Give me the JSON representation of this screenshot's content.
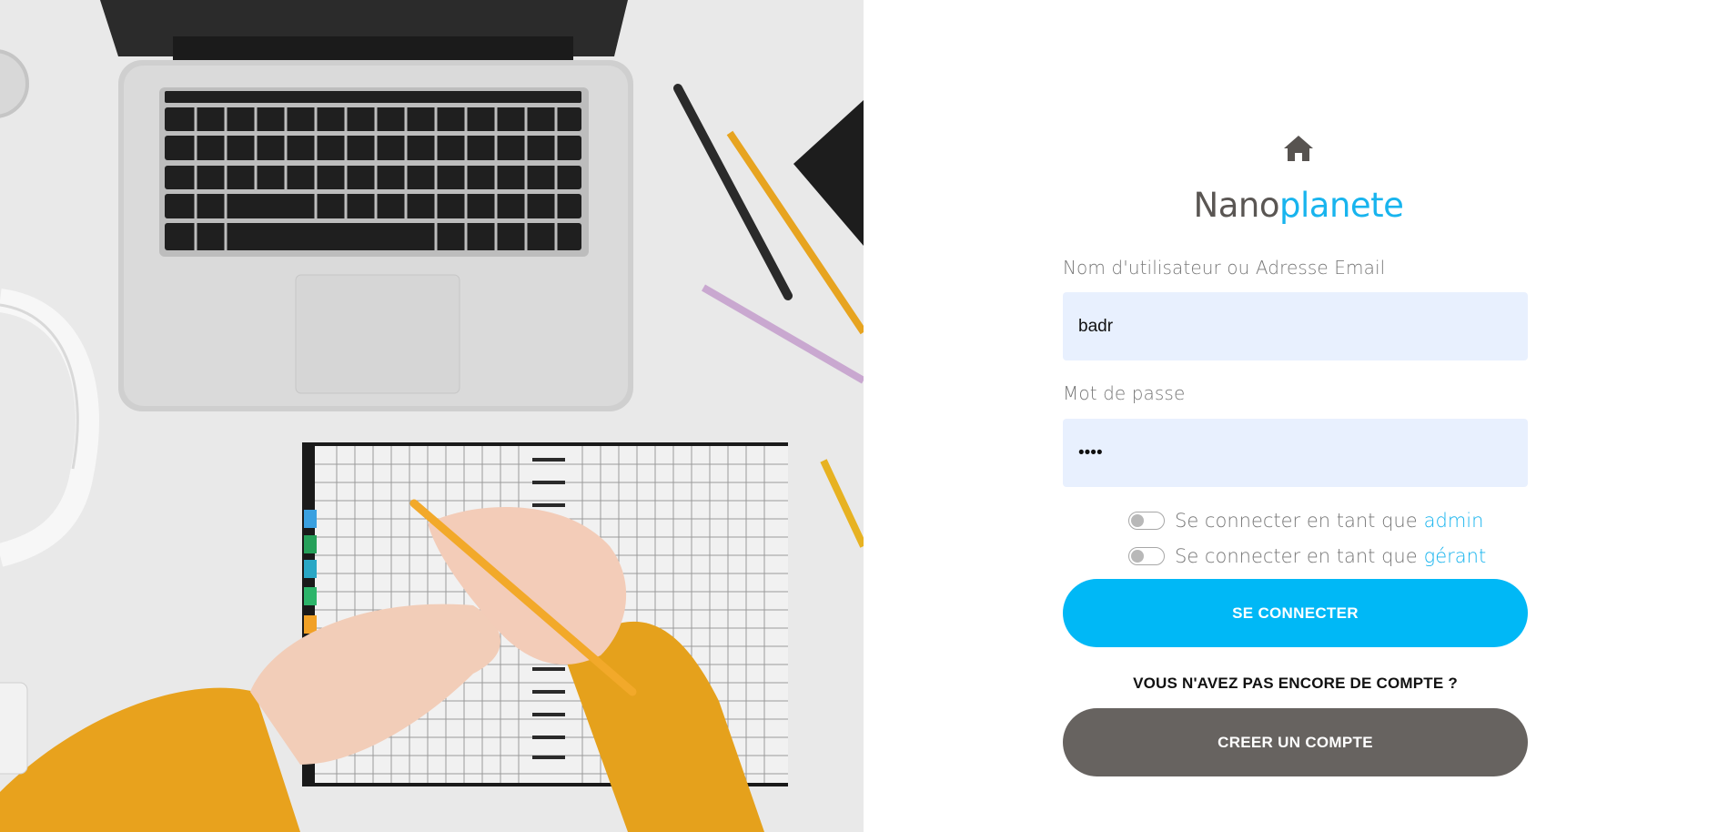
{
  "brand": {
    "part1": "Nano",
    "part2": "planete",
    "home_icon": "home-icon"
  },
  "login_form": {
    "username_label": "Nom d'utilisateur ou Adresse Email",
    "username_value": "badr",
    "password_label": "Mot de passe",
    "password_value": "badr",
    "toggle_admin": {
      "prefix": "Se connecter en tant que",
      "role": "admin",
      "checked": false
    },
    "toggle_manager": {
      "prefix": "Se connecter en tant que",
      "role": "gérant",
      "checked": false
    },
    "submit_label": "SE CONNECTER",
    "signup_prompt": "VOUS N'AVEZ PAS ENCORE DE COMPTE ?",
    "signup_label": "CREER UN COMPTE"
  },
  "colors": {
    "accent": "#00b8f6",
    "brand_blue": "#18b4ee",
    "secondary_button": "#676360",
    "input_bg": "#e8f0fe"
  }
}
